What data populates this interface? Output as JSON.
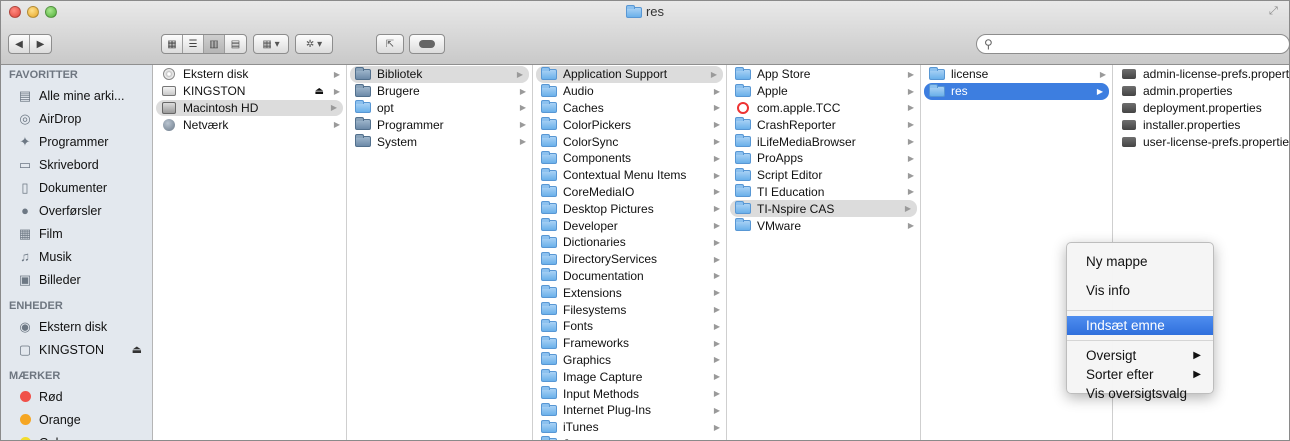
{
  "window": {
    "title": "res"
  },
  "sidebar": {
    "sections": [
      {
        "header": "FAVORITTER",
        "items": [
          {
            "label": "Alle mine arki...",
            "icon": "all-files-icon"
          },
          {
            "label": "AirDrop",
            "icon": "airdrop-icon"
          },
          {
            "label": "Programmer",
            "icon": "applications-icon"
          },
          {
            "label": "Skrivebord",
            "icon": "desktop-icon"
          },
          {
            "label": "Dokumenter",
            "icon": "documents-icon"
          },
          {
            "label": "Overførsler",
            "icon": "downloads-icon"
          },
          {
            "label": "Film",
            "icon": "movies-icon"
          },
          {
            "label": "Musik",
            "icon": "music-icon"
          },
          {
            "label": "Billeder",
            "icon": "pictures-icon"
          }
        ]
      },
      {
        "header": "ENHEDER",
        "items": [
          {
            "label": "Ekstern disk",
            "icon": "external-disk-icon"
          },
          {
            "label": "KINGSTON",
            "icon": "usb-drive-icon",
            "eject": "⏏"
          }
        ]
      },
      {
        "header": "MÆRKER",
        "items": [
          {
            "label": "Rød",
            "color": "#f0514a"
          },
          {
            "label": "Orange",
            "color": "#f5a623"
          },
          {
            "label": "Gul",
            "color": "#f2dc2c"
          }
        ]
      }
    ]
  },
  "columns": [
    {
      "items": [
        {
          "label": "Ekstern disk",
          "icon": "ext"
        },
        {
          "label": "KINGSTON",
          "icon": "disk",
          "eject": "⏏"
        },
        {
          "label": "Macintosh HD",
          "icon": "hd",
          "selected": "gray"
        },
        {
          "label": "Netværk",
          "icon": "globe"
        }
      ]
    },
    {
      "items": [
        {
          "label": "Bibliotek",
          "icon": "lib",
          "selected": "gray"
        },
        {
          "label": "Brugere",
          "icon": "lib"
        },
        {
          "label": "opt",
          "icon": "folder"
        },
        {
          "label": "Programmer",
          "icon": "lib"
        },
        {
          "label": "System",
          "icon": "lib"
        }
      ]
    },
    {
      "items": [
        {
          "label": "Application Support",
          "selected": "gray"
        },
        {
          "label": "Audio"
        },
        {
          "label": "Caches"
        },
        {
          "label": "ColorPickers"
        },
        {
          "label": "ColorSync"
        },
        {
          "label": "Components"
        },
        {
          "label": "Contextual Menu Items"
        },
        {
          "label": "CoreMediaIO"
        },
        {
          "label": "Desktop Pictures"
        },
        {
          "label": "Developer"
        },
        {
          "label": "Dictionaries"
        },
        {
          "label": "DirectoryServices"
        },
        {
          "label": "Documentation"
        },
        {
          "label": "Extensions"
        },
        {
          "label": "Filesystems"
        },
        {
          "label": "Fonts"
        },
        {
          "label": "Frameworks"
        },
        {
          "label": "Graphics"
        },
        {
          "label": "Image Capture"
        },
        {
          "label": "Input Methods"
        },
        {
          "label": "Internet Plug-Ins"
        },
        {
          "label": "iTunes"
        },
        {
          "label": "Java"
        }
      ]
    },
    {
      "items": [
        {
          "label": "App Store"
        },
        {
          "label": "Apple"
        },
        {
          "label": "com.apple.TCC",
          "icon": "badge"
        },
        {
          "label": "CrashReporter"
        },
        {
          "label": "iLifeMediaBrowser"
        },
        {
          "label": "ProApps"
        },
        {
          "label": "Script Editor"
        },
        {
          "label": "TI Education"
        },
        {
          "label": "TI-Nspire CAS",
          "selected": "gray"
        },
        {
          "label": "VMware"
        }
      ]
    },
    {
      "items": [
        {
          "label": "license"
        },
        {
          "label": "res",
          "selected": "blue"
        }
      ]
    },
    {
      "items": [
        {
          "label": "admin-license-prefs.properties",
          "icon": "file"
        },
        {
          "label": "admin.properties",
          "icon": "file"
        },
        {
          "label": "deployment.properties",
          "icon": "file"
        },
        {
          "label": "installer.properties",
          "icon": "file"
        },
        {
          "label": "user-license-prefs.properties",
          "icon": "file"
        }
      ]
    }
  ],
  "context_menu": {
    "items": [
      {
        "label": "Ny mappe",
        "tall": true
      },
      {
        "label": "Vis info",
        "tall": true
      },
      {
        "sep": true
      },
      {
        "label": "Indsæt emne",
        "active": true
      },
      {
        "sep": true
      },
      {
        "label": "Oversigt",
        "submenu": "▶"
      },
      {
        "label": "Sorter efter",
        "submenu": "▶"
      },
      {
        "label": "Vis oversigtsvalg"
      }
    ]
  }
}
